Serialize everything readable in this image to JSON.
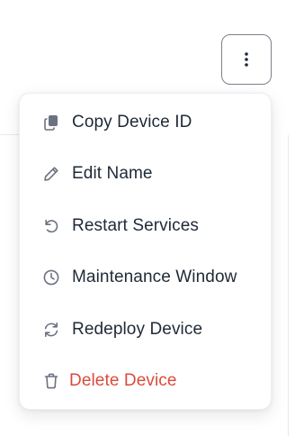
{
  "menu": {
    "items": [
      {
        "label": "Copy Device ID",
        "icon": "copy-icon"
      },
      {
        "label": "Edit Name",
        "icon": "pencil-icon"
      },
      {
        "label": "Restart Services",
        "icon": "restart-icon"
      },
      {
        "label": "Maintenance Window",
        "icon": "clock-icon"
      },
      {
        "label": "Redeploy Device",
        "icon": "refresh-icon"
      },
      {
        "label": "Delete Device",
        "icon": "trash-icon"
      }
    ]
  },
  "kebab": {
    "icon": "more-vertical-icon"
  },
  "colors": {
    "text": "#1f2937",
    "icon": "#6b7280",
    "danger": "#dc4a3d",
    "border": "#7b818b"
  }
}
